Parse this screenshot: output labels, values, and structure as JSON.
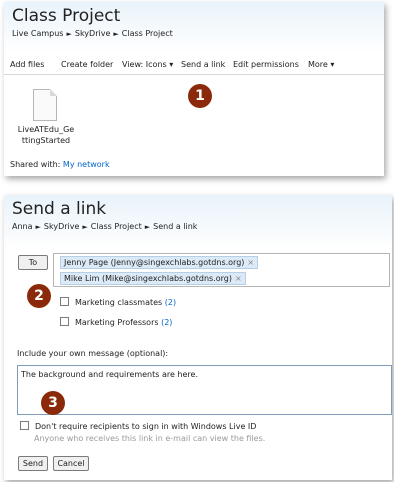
{
  "panel1": {
    "title": "Class Project",
    "breadcrumb": [
      "Live Campus",
      "SkyDrive",
      "Class Project"
    ],
    "separator": "►",
    "toolbar": {
      "add_files": "Add files",
      "create_folder": "Create folder",
      "view": "View: Icons ▾",
      "send_link": "Send a link",
      "edit_permissions": "Edit permissions",
      "more": "More ▾"
    },
    "file": {
      "name": "LiveATEdu_GettingStarted",
      "name_line1": "LiveATEdu_Ge",
      "name_line2": "ttingStarted"
    },
    "shared_label": "Shared with:",
    "shared_value": "My network"
  },
  "panel2": {
    "title": "Send a link",
    "breadcrumb": [
      "Anna",
      "SkyDrive",
      "Class Project",
      "Send a link"
    ],
    "separator": "►",
    "to_button": "To",
    "recipients": [
      {
        "label": "Jenny Page  (Jenny@singexchlabs.gotdns.org)",
        "remove": "×"
      },
      {
        "label": "Mike Lim  (Mike@singexchlabs.gotdns.org)",
        "remove": "×"
      }
    ],
    "groups": [
      {
        "label": "Marketing classmates",
        "count": "(2)"
      },
      {
        "label": "Marketing Professors",
        "count": "(2)"
      }
    ],
    "message_label": "Include your own message (optional):",
    "message_value": "The background and requirements are here.",
    "signin_label": "Don't require recipients to sign in with Windows Live ID",
    "signin_note": "Anyone who receives this link in e-mail can view the files.",
    "send_button": "Send",
    "cancel_button": "Cancel"
  },
  "callouts": [
    "1",
    "2",
    "3"
  ],
  "colors": {
    "callout": "#8a2a0a",
    "link": "#0066cc",
    "header_gradient": "#e9f3fb"
  }
}
